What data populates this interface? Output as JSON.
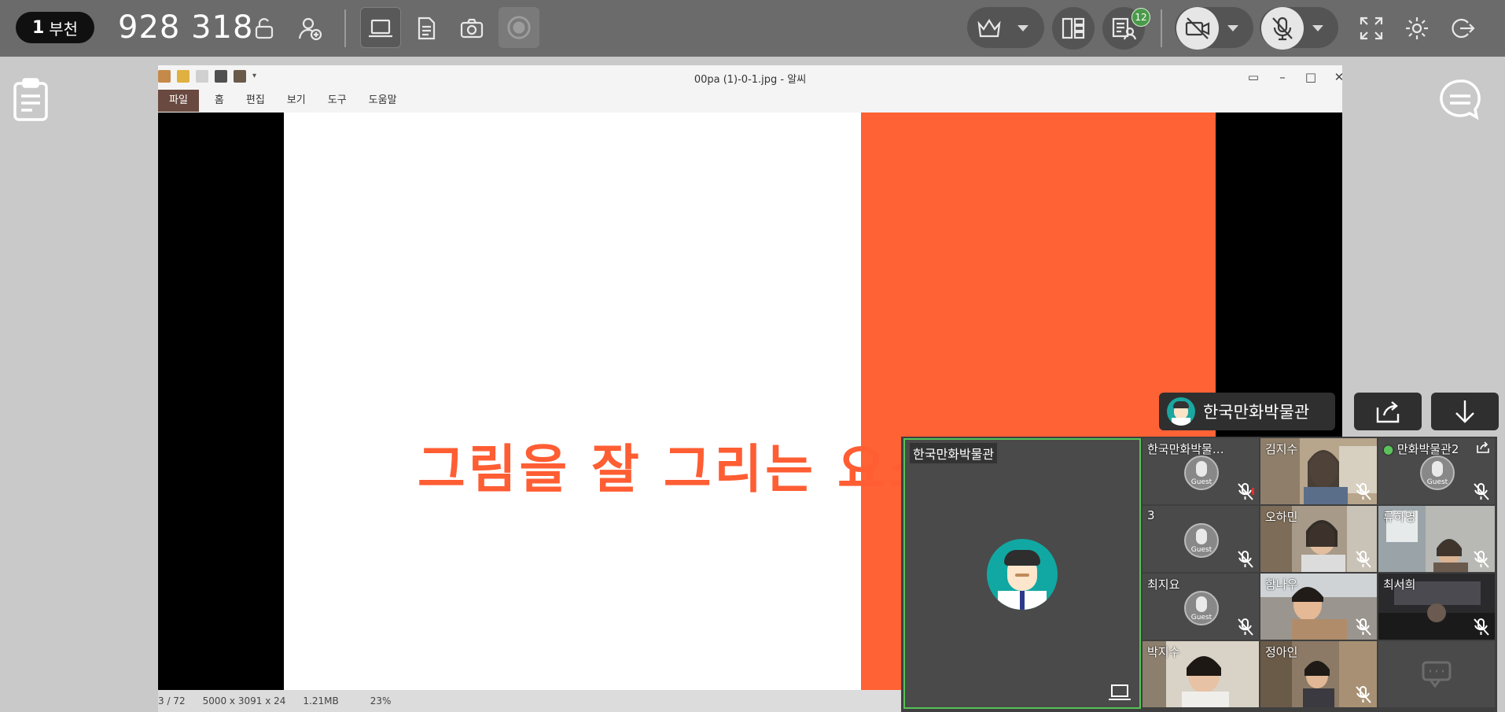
{
  "toolbar": {
    "room_number": "1",
    "room_name": "부천",
    "room_id": "928 318",
    "chat_badge": "12",
    "colors": {
      "bar": "#6b6b6b",
      "badge": "#4a9a4a"
    }
  },
  "viewer": {
    "title": "00pa (1)-0-1.jpg - 알씨",
    "menu": [
      "파일",
      "홈",
      "편집",
      "보기",
      "도구",
      "도움말"
    ],
    "slide_text": "그림을 잘 그리는 요소?",
    "status": {
      "page": "3 / 72",
      "dims": "5000 x 3091 x 24",
      "size": "1.21MB",
      "zoom": "23%"
    },
    "colors": {
      "slide_accent": "#ff6235",
      "slide_text": "#ff5d33"
    }
  },
  "presenter": {
    "name": "한국만화박물관"
  },
  "participants": {
    "main": {
      "name": "한국만화박물관"
    },
    "tiles": [
      {
        "name": "한국만화박물…",
        "kind": "guest"
      },
      {
        "name": "김지수",
        "kind": "video"
      },
      {
        "name": "만화박물관2",
        "kind": "guest"
      },
      {
        "name": "3",
        "kind": "guest"
      },
      {
        "name": "오하민",
        "kind": "video"
      },
      {
        "name": "류하영",
        "kind": "video"
      },
      {
        "name": "최지요",
        "kind": "guest"
      },
      {
        "name": "함나우",
        "kind": "video"
      },
      {
        "name": "최서희",
        "kind": "video"
      },
      {
        "name": "박지수",
        "kind": "video"
      },
      {
        "name": "정아인",
        "kind": "video"
      }
    ],
    "guest_label": "Guest"
  }
}
